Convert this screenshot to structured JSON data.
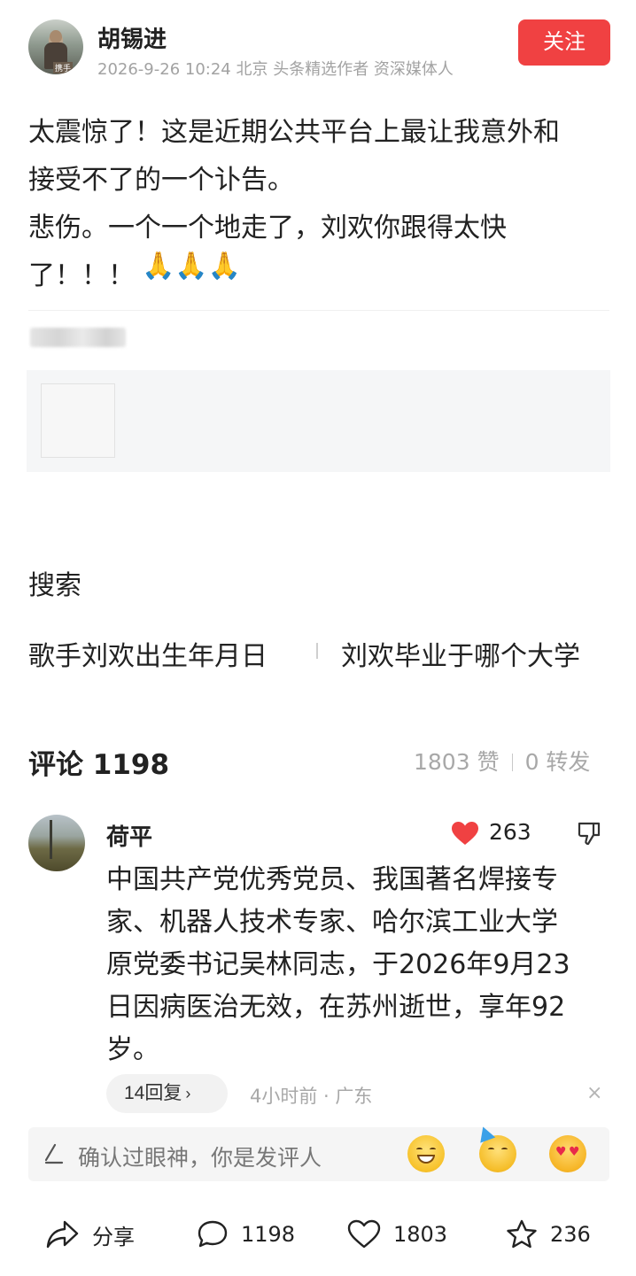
{
  "author": {
    "name": "胡锡进",
    "meta": "2026-9-26 10:24 北京 头条精选作者 资深媒体人",
    "avatar_tag": "携手",
    "follow_label": "关注"
  },
  "post": {
    "lines": [
      "太震惊了！这是近期公共平台上最让我意外和",
      "接受不了的一个讣告。",
      "悲伤。一个一个地走了，刘欢你跟得太快",
      "了！！！"
    ],
    "emojis": [
      "🙏",
      "🙏",
      "🙏"
    ]
  },
  "search": {
    "title": "搜索",
    "links": [
      "歌手刘欢出生年月日",
      "刘欢毕业于哪个大学"
    ]
  },
  "comments_header": {
    "title": "评论 1198",
    "likes": "1803 赞",
    "reposts": "0 转发"
  },
  "comment": {
    "name": "荷平",
    "likes": "263",
    "lines": [
      "中国共产党优秀党员、我国著名焊接专",
      "家、机器人技术专家、哈尔滨工业大学",
      "原党委书记吴林同志，于2026年9月23",
      "日因病医治无效，在苏州逝世，享年92",
      "岁。"
    ],
    "reply_label": "14回复",
    "meta": "4小时前 · 广东",
    "close": "×"
  },
  "input": {
    "placeholder": "确认过眼神，你是发评人"
  },
  "bottom_bar": {
    "share": "分享",
    "comments": "1198",
    "likes": "1803",
    "favorites": "236"
  },
  "colors": {
    "accent": "#f04142",
    "muted": "#a8a8a8",
    "heart": "#f04142"
  }
}
